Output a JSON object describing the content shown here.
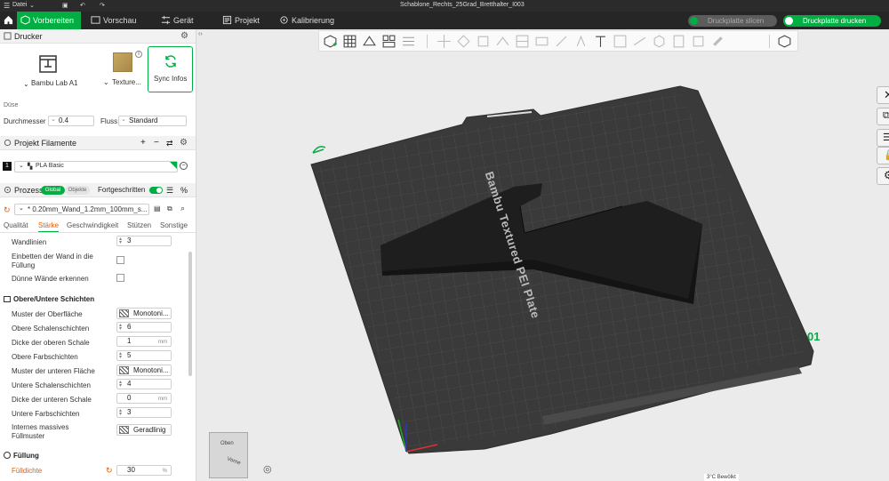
{
  "titlebar": {
    "menu": "Datei",
    "file_name": "Schablone_Rechts_25Grad_Bretthalter_I003"
  },
  "nav": {
    "tabs": [
      {
        "label": "Vorbereiten",
        "icon": "cube-icon"
      },
      {
        "label": "Vorschau",
        "icon": "preview-icon"
      },
      {
        "label": "Gerät",
        "icon": "device-icon"
      },
      {
        "label": "Projekt",
        "icon": "project-icon"
      },
      {
        "label": "Kalibrierung",
        "icon": "calibration-icon"
      }
    ],
    "slice_label": "Druckplatte slicen",
    "print_label": "Druckplatte drucken"
  },
  "printer": {
    "title": "Drucker",
    "printer_name": "Bambu Lab A1",
    "plate_name": "Texture...",
    "sync_label": "Sync Infos",
    "nozzle_label": "Düse",
    "diameter_label": "Durchmesser",
    "diameter_value": "0.4",
    "flow_label": "Fluss",
    "flow_value": "Standard"
  },
  "filaments": {
    "title": "Projekt Filamente",
    "slot": "1",
    "name": "PLA Basic"
  },
  "process": {
    "title": "Prozess",
    "global": "Global",
    "objects": "Objekte",
    "advanced": "Fortgeschritten",
    "preset": "* 0.20mm_Wand_1.2mm_100mm_s...",
    "tabs": [
      "Qualität",
      "Stärke",
      "Geschwindigkeit",
      "Stützen",
      "Sonstige"
    ]
  },
  "settings": {
    "wall_lines_label": "Wandlinien",
    "wall_lines_value": "3",
    "embed_walls_label_1": "Einbetten der Wand in die",
    "embed_walls_label_2": "Füllung",
    "thin_walls_label": "Dünne Wände erkennen",
    "top_bottom_title": "Obere/Untere Schichten",
    "top_pattern_label": "Muster der Oberfläche",
    "top_pattern_value": "Monotoni...",
    "top_shell_label": "Obere Schalenschichten",
    "top_shell_value": "6",
    "top_thickness_label": "Dicke der oberen Schale",
    "top_thickness_value": "1",
    "top_thickness_unit": "mm",
    "top_color_label": "Obere Farbschichten",
    "top_color_value": "5",
    "bottom_pattern_label": "Muster der unteren Fläche",
    "bottom_pattern_value": "Monotoni...",
    "bottom_shell_label": "Untere Schalenschichten",
    "bottom_shell_value": "4",
    "bottom_thickness_label": "Dicke der unteren Schale",
    "bottom_thickness_value": "0",
    "bottom_thickness_unit": "mm",
    "bottom_color_label": "Untere Farbschichten",
    "bottom_color_value": "3",
    "internal_solid_label_1": "Internes massives",
    "internal_solid_label_2": "Füllmuster",
    "internal_solid_value": "Geradlinig",
    "infill_title": "Füllung",
    "infill_density_label": "Fülldichte",
    "infill_density_value": "30",
    "infill_density_unit": "%"
  },
  "viewport": {
    "plate_text": "Bambu Textured PEI Plate",
    "plate_number": "01",
    "cube_top": "Oben",
    "cube_front": "Vorne",
    "status": "3°C Bewölkt"
  },
  "colors": {
    "accent": "#00ae42",
    "active_tab_text": "#e65c00",
    "bed": "#3a3a3a",
    "model": "#2a2a2a"
  }
}
